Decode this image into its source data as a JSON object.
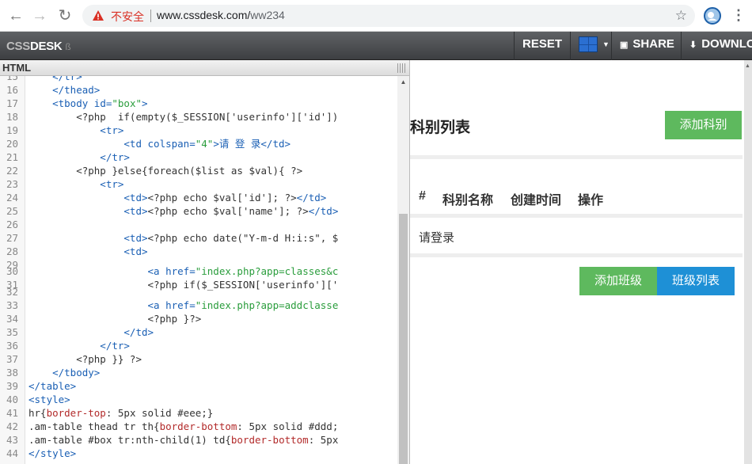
{
  "browser": {
    "back_icon": "arrow-left-icon",
    "forward_icon": "arrow-right-icon",
    "reload_icon": "reload-icon",
    "insecure_label": "不安全",
    "url_host": "www.cssdesk.com/",
    "url_path": "ww234"
  },
  "toolbar": {
    "logo_css": "CSS",
    "logo_desk": "DESK",
    "logo_tag": "ß",
    "reset": "RESET",
    "share": "SHARE",
    "download": "DOWNLO"
  },
  "editor": {
    "title": "HTML",
    "lines": [
      {
        "n": "15",
        "y": -8
      },
      {
        "n": "16"
      },
      {
        "n": "17"
      },
      {
        "n": "18"
      },
      {
        "n": "19"
      },
      {
        "n": "20"
      },
      {
        "n": "21"
      },
      {
        "n": "22"
      },
      {
        "n": "23"
      },
      {
        "n": "24"
      },
      {
        "n": "25"
      },
      {
        "n": "26"
      },
      {
        "n": "27"
      },
      {
        "n": "28"
      },
      {
        "n": "29"
      },
      {
        "n": "30"
      },
      {
        "n": "31"
      },
      {
        "n": "32"
      },
      {
        "n": "33"
      },
      {
        "n": "34"
      },
      {
        "n": "35"
      },
      {
        "n": "36"
      },
      {
        "n": "37"
      },
      {
        "n": "38"
      },
      {
        "n": "39"
      },
      {
        "n": "40"
      },
      {
        "n": "41"
      },
      {
        "n": "42"
      },
      {
        "n": "43"
      },
      {
        "n": "44"
      }
    ],
    "code": {
      "l15": "    </tr>",
      "l16": "    </thead>",
      "l17_a": "    <tbody ",
      "l17_b": "id=",
      "l17_c": "\"box\"",
      "l17_d": ">",
      "l18": "        <?php  if(empty($_SESSION['userinfo']['id'])",
      "l19": "            <tr>",
      "l20_a": "                <td ",
      "l20_b": "colspan=",
      "l20_c": "\"4\"",
      "l20_d": ">请 登 录</td>",
      "l21": "            </tr>",
      "l22": "        <?php }else{foreach($list as $val){ ?>",
      "l23": "            <tr>",
      "l24_a": "                <td>",
      "l24_b": "<?php echo $val['id']; ?>",
      "l24_c": "</td>",
      "l25_a": "                <td>",
      "l25_b": "<?php echo $val['name']; ?>",
      "l25_c": "</td>",
      "l26": "",
      "l27_a": "                <td>",
      "l27_b": "<?php echo date(\"Y-m-d H:i:s\", $",
      "l28": "                <td>",
      "l29": "",
      "l30_a": "                    <a ",
      "l30_b": "href=",
      "l30_c": "\"index.php?app=classes&c",
      "l31": "                    <?php if($_SESSION['userinfo']['",
      "l32": "",
      "l33_a": "                    <a ",
      "l33_b": "href=",
      "l33_c": "\"index.php?app=addclasse",
      "l34": "                    <?php }?>",
      "l35": "                </td>",
      "l36": "            </tr>",
      "l37": "        <?php }} ?>",
      "l38": "    </tbody>",
      "l39": "</table>",
      "l40": "<style>",
      "l41_a": "hr{",
      "l41_b": "border-top",
      "l41_c": ": 5px solid #eee;}",
      "l42_a": ".am-table thead tr th{",
      "l42_b": "border-bottom",
      "l42_c": ": 5px solid #ddd;",
      "l43_a": ".am-table #box tr:nth-child(1) td{",
      "l43_b": "border-bottom",
      "l43_c": ": 5px",
      "l44": "</style>"
    }
  },
  "preview": {
    "title": "科别列表",
    "add_subject": "添加科别",
    "headers": [
      "#",
      "科别名称",
      "创建时间",
      "操作"
    ],
    "login_cell": "请登录",
    "add_class": "添加班级",
    "class_list": "班级列表"
  },
  "colors": {
    "green": "#5eb95e",
    "blue": "#1e90d6",
    "insecure": "#d93025"
  }
}
